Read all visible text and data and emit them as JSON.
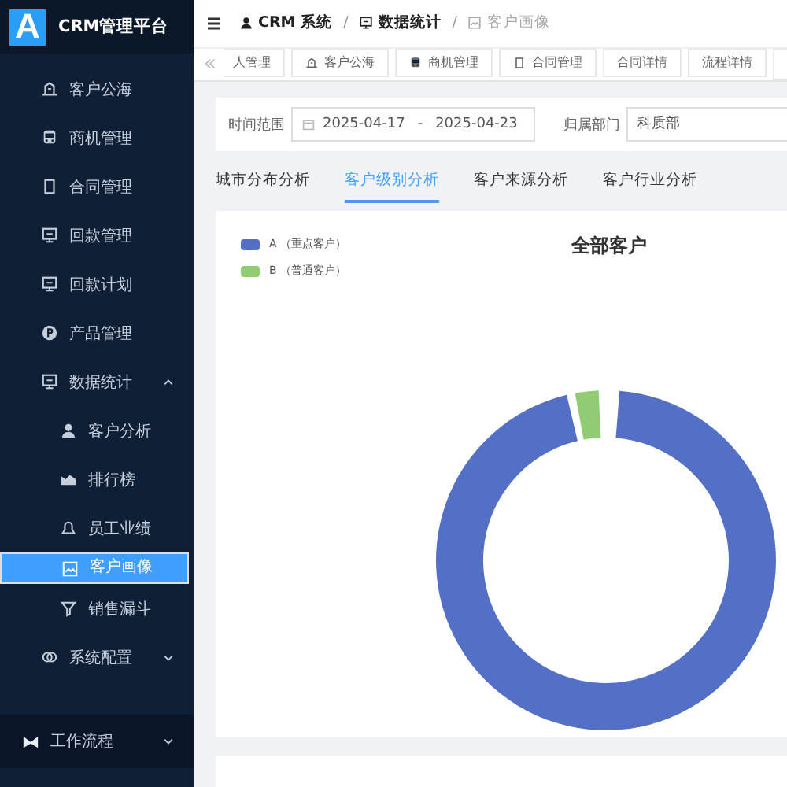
{
  "logo": {
    "letter": "A",
    "title": "CRM管理平台"
  },
  "sidebar": {
    "items": [
      {
        "label": "客户公海",
        "kind": "sea",
        "selected": false
      },
      {
        "label": "商机管理",
        "kind": "bus",
        "selected": false
      },
      {
        "label": "合同管理",
        "kind": "doc",
        "selected": false
      },
      {
        "label": "回款管理",
        "kind": "money",
        "selected": false
      },
      {
        "label": "回款计划",
        "kind": "plan",
        "selected": false
      },
      {
        "label": "产品管理",
        "kind": "product",
        "selected": false
      },
      {
        "label": "数据统计",
        "kind": "stats",
        "selected": false,
        "expanded": true,
        "children": [
          {
            "label": "客户分析",
            "kind": "user",
            "selected": false
          },
          {
            "label": "排行榜",
            "kind": "chart",
            "selected": false
          },
          {
            "label": "员工业绩",
            "kind": "bell",
            "selected": false
          },
          {
            "label": "客户画像",
            "kind": "image",
            "selected": true
          },
          {
            "label": "销售漏斗",
            "kind": "funnel",
            "selected": false
          }
        ]
      },
      {
        "label": "系统配置",
        "kind": "config",
        "selected": false,
        "expanded": false
      }
    ],
    "footer": {
      "label": "工作流程",
      "expanded": false
    }
  },
  "breadcrumb": [
    {
      "label": "CRM 系统",
      "kind": "user",
      "current": false
    },
    {
      "separator": "/",
      "label": "数据统计",
      "kind": "stats",
      "current": false
    },
    {
      "separator": "/",
      "label": "客户画像",
      "kind": "image",
      "current": true
    }
  ],
  "page_tabs": [
    {
      "label": "人管理",
      "kind": "plain"
    },
    {
      "label": "客户公海",
      "kind": "sea"
    },
    {
      "label": "商机管理",
      "kind": "bus"
    },
    {
      "label": "合同管理",
      "kind": "doc"
    },
    {
      "label": "合同详情",
      "kind": "plain"
    },
    {
      "label": "流程详情",
      "kind": "plain"
    }
  ],
  "filters": {
    "time_label": "时间范围",
    "start": "2025-04-17",
    "separator": "-",
    "end": "2025-04-23",
    "dept_label": "归属部门",
    "dept": "科质部"
  },
  "analysis_tabs": [
    {
      "label": "城市分布分析",
      "selected": false
    },
    {
      "label": "客户级别分析",
      "selected": true
    },
    {
      "label": "客户来源分析",
      "selected": false
    },
    {
      "label": "客户行业分析",
      "selected": false
    }
  ],
  "chart": {
    "title": "全部客户",
    "legend": [
      {
        "label": "A （重点客户）",
        "color": "#5470c6"
      },
      {
        "label": "B （普通客户）",
        "color": "#91cc75"
      }
    ]
  }
}
